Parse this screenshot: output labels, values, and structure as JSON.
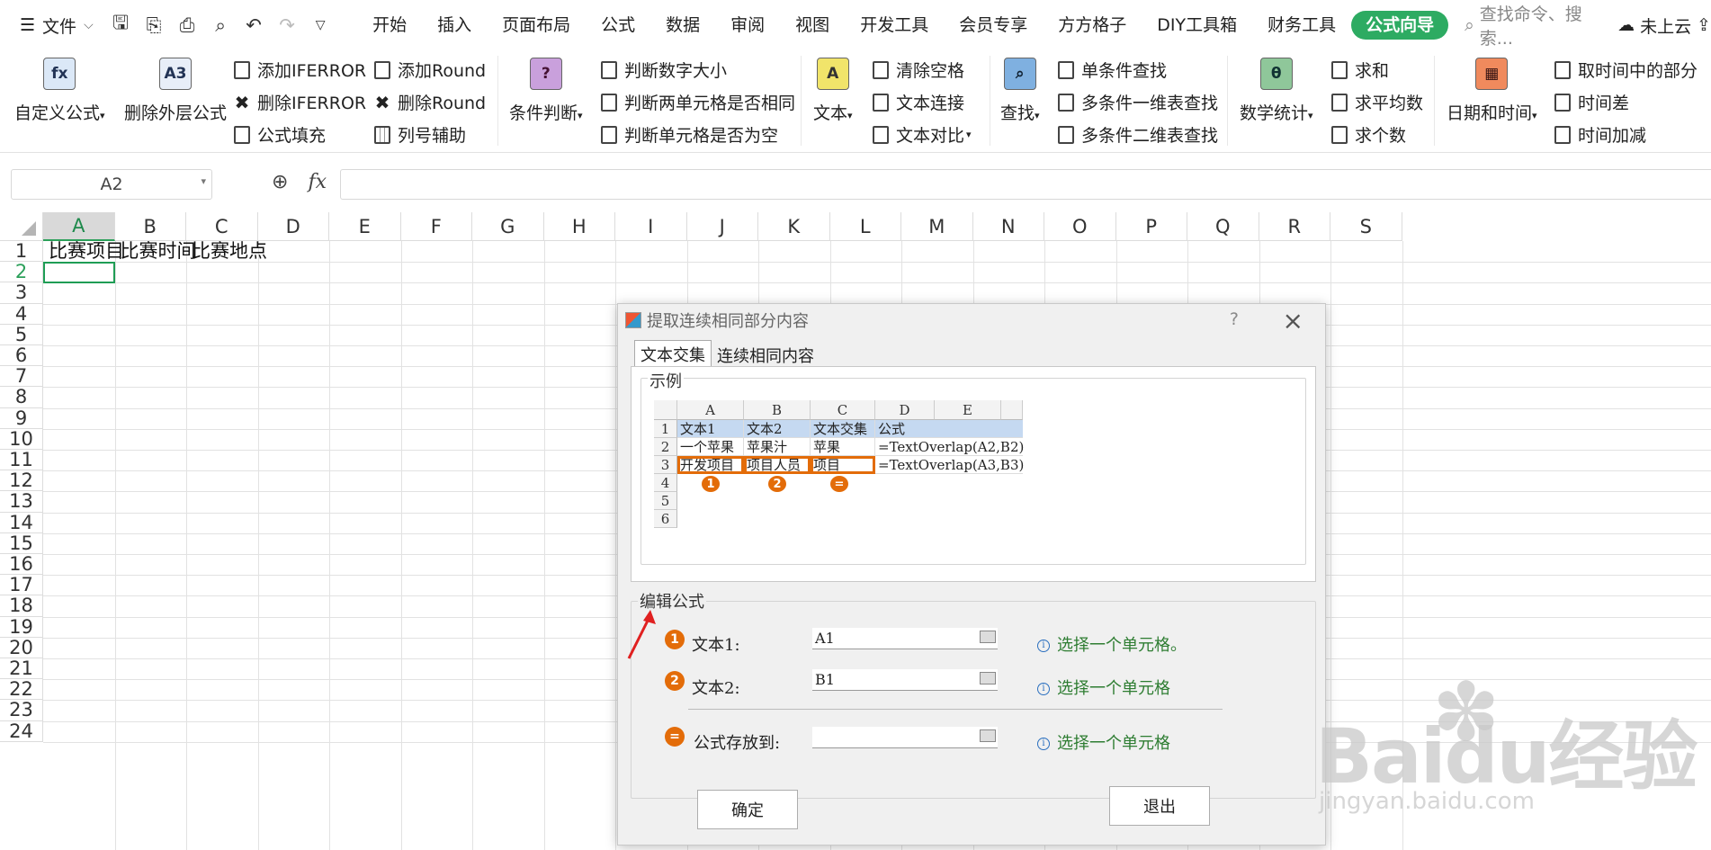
{
  "menubar": {
    "file_label": "文件",
    "tabs": [
      "开始",
      "插入",
      "页面布局",
      "公式",
      "数据",
      "审阅",
      "视图",
      "开发工具",
      "会员专享",
      "方方格子",
      "DIY工具箱",
      "财务工具",
      "公式向导"
    ],
    "active_tab_index": 12,
    "search_placeholder": "查找命令、搜索...",
    "cloud_label": "未上云"
  },
  "ribbon": {
    "custom_formula": "自定义公式",
    "remove_outer": "删除外层公式",
    "add_iferror": "添加IFERROR",
    "del_iferror": "删除IFERROR",
    "formula_fill": "公式填充",
    "add_round": "添加Round",
    "del_round": "删除Round",
    "col_helper": "列号辅助",
    "condition": "条件判断",
    "cond_items": [
      "判断数字大小",
      "判断两单元格是否相同",
      "判断单元格是否为空"
    ],
    "text": "文本",
    "text_items": [
      "清除空格",
      "文本连接",
      "文本对比"
    ],
    "find": "查找",
    "find_items": [
      "单条件查找",
      "多条件一维表查找",
      "多条件二维表查找"
    ],
    "math": "数学统计",
    "math_items": [
      "求和",
      "求平均数",
      "求个数"
    ],
    "date": "日期和时间",
    "date_items": [
      "取时间中的部分",
      "时间差",
      "时间加减"
    ]
  },
  "formula_bar": {
    "name_box": "A2",
    "fx": "fx"
  },
  "sheet": {
    "columns": [
      "A",
      "B",
      "C",
      "D",
      "E",
      "F",
      "G",
      "H",
      "I",
      "J",
      "K",
      "L",
      "M",
      "N",
      "O",
      "P",
      "Q",
      "R",
      "S"
    ],
    "rows": [
      "1",
      "2",
      "3",
      "4",
      "5",
      "6",
      "7",
      "8",
      "9",
      "10",
      "11",
      "12",
      "13",
      "14",
      "15",
      "16",
      "17",
      "18",
      "19",
      "20",
      "21",
      "22",
      "23",
      "24"
    ],
    "cells": {
      "A1": "比赛项目",
      "B1": "比赛时间",
      "C1": "比赛地点"
    },
    "selected": "A2"
  },
  "dialog": {
    "title": "提取连续相同部分内容",
    "help": "?",
    "tabs": [
      "文本交集",
      "连续相同内容"
    ],
    "example_group": "示例",
    "example": {
      "cols": [
        "A",
        "B",
        "C",
        "D",
        "E"
      ],
      "rows": [
        "1",
        "2",
        "3",
        "4",
        "5",
        "6"
      ],
      "r1": [
        "文本1",
        "文本2",
        "文本交集",
        "公式"
      ],
      "r2": [
        "一个苹果",
        "苹果汁",
        "苹果",
        "=TextOverlap(A2,B2)"
      ],
      "r3": [
        "开发项目",
        "项目人员",
        "项目",
        "=TextOverlap(A3,B3)"
      ],
      "badges": [
        "1",
        "2",
        "="
      ]
    },
    "edit_group": "编辑公式",
    "text1_label": "文本1:",
    "text1_value": "A1",
    "text2_label": "文本2:",
    "text2_value": "B1",
    "store_label": "公式存放到:",
    "store_value": "",
    "hint1": "选择一个单元格。",
    "hint2": "选择一个单元格",
    "hint3": "选择一个单元格",
    "badges": [
      "1",
      "2",
      "="
    ],
    "ok": "确定",
    "exit": "退出"
  },
  "watermark": {
    "main": "Baidu经验",
    "sub": "jingyan.baidu.com"
  }
}
